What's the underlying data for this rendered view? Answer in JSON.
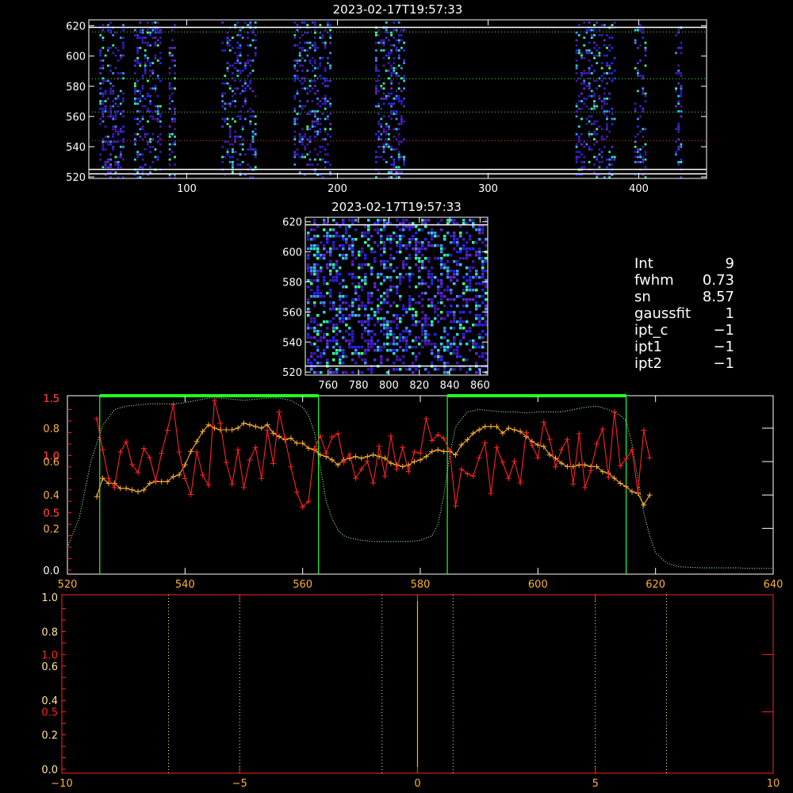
{
  "colors": {
    "background": "#000000",
    "axes": "#ffffff",
    "red": "#ff2222",
    "orange": "#ffb030",
    "green": "#22ff22",
    "light_green": "#aaffaa",
    "pixel_palette": [
      "#3a1aa8",
      "#5a2ad0",
      "#2222ff",
      "#3f8cff",
      "#2ad6d6",
      "#40ff90"
    ]
  },
  "info_panel": [
    {
      "key": "Int",
      "value": "9"
    },
    {
      "key": "fwhm",
      "value": "0.73"
    },
    {
      "key": "sn",
      "value": "8.57"
    },
    {
      "key": "gaussfit",
      "value": "1"
    },
    {
      "key": "ipt_c",
      "value": "−1"
    },
    {
      "key": "ipt1",
      "value": "−1"
    },
    {
      "key": "ipt2",
      "value": "−1"
    }
  ],
  "chart_data": [
    {
      "id": "top-image",
      "type": "heatmap",
      "title": "2023-02-17T19:57:33",
      "xlim": [
        35,
        445
      ],
      "ylim": [
        519,
        624
      ],
      "xticks": [
        100,
        200,
        300,
        400
      ],
      "yticks": [
        520,
        540,
        560,
        580,
        600,
        620
      ],
      "bands_x": [
        [
          42,
          58
        ],
        [
          65,
          82
        ],
        [
          88,
          92
        ],
        [
          123,
          146
        ],
        [
          171,
          196
        ],
        [
          225,
          244
        ],
        [
          358,
          384
        ],
        [
          397,
          404
        ],
        [
          424,
          428
        ]
      ],
      "h_lines_white": [
        619,
        525,
        522
      ],
      "h_lines_green_dotted": [
        616,
        585,
        563
      ],
      "h_lines_red_dotted": [
        544
      ]
    },
    {
      "id": "middle-image",
      "type": "heatmap",
      "title": "2023-02-17T19:57:33",
      "xlim": [
        745,
        865
      ],
      "ylim": [
        518,
        623
      ],
      "xticks": [
        760,
        780,
        800,
        820,
        840,
        860
      ],
      "yticks": [
        520,
        540,
        560,
        580,
        600,
        620
      ],
      "h_lines_white": [
        618,
        524
      ]
    },
    {
      "id": "spectrum",
      "type": "line",
      "xlim": [
        520,
        640
      ],
      "xticks": [
        520,
        540,
        560,
        580,
        600,
        620,
        640
      ],
      "left_axis_white": {
        "ylim": [
          0,
          1.5
        ],
        "ticks": [
          "0.0",
          "0.5",
          "1.0",
          "1.5"
        ]
      },
      "left_axis_orange": {
        "ylim": [
          -0.05,
          0.98
        ],
        "ticks": [
          "0.2",
          "0.4",
          "0.6",
          "0.8"
        ]
      },
      "left_axis_red": {
        "ylim": [
          0,
          1.5
        ],
        "ticks": [
          "0.5",
          "1.0",
          "1.5"
        ]
      },
      "green_windows": [
        [
          525.5,
          562.7
        ],
        [
          584.6,
          615
        ]
      ],
      "series": [
        {
          "color_key": "light_green",
          "style": "dotted",
          "axis": "white",
          "x": [
            520,
            522,
            524,
            526,
            528,
            530,
            532,
            534,
            536,
            538,
            540,
            542,
            544,
            546,
            548,
            550,
            552,
            554,
            556,
            558,
            560,
            561,
            562,
            563,
            564,
            565,
            566,
            567,
            568,
            570,
            572,
            574,
            576,
            578,
            580,
            582,
            583,
            584,
            585,
            586,
            588,
            590,
            592,
            594,
            596,
            598,
            600,
            602,
            604,
            606,
            608,
            610,
            612,
            614,
            615,
            616,
            617,
            618,
            619,
            620,
            622,
            624,
            626,
            628,
            630,
            632,
            634,
            636,
            638,
            640
          ],
          "values": [
            0.2,
            0.45,
            0.95,
            1.26,
            1.4,
            1.43,
            1.44,
            1.45,
            1.45,
            1.45,
            1.46,
            1.48,
            1.5,
            1.5,
            1.49,
            1.48,
            1.49,
            1.5,
            1.5,
            1.48,
            1.42,
            1.35,
            1.2,
            0.9,
            0.6,
            0.45,
            0.35,
            0.3,
            0.28,
            0.26,
            0.25,
            0.25,
            0.25,
            0.25,
            0.26,
            0.3,
            0.4,
            0.65,
            1.0,
            1.25,
            1.38,
            1.4,
            1.39,
            1.38,
            1.38,
            1.37,
            1.38,
            1.38,
            1.38,
            1.4,
            1.42,
            1.43,
            1.4,
            1.35,
            1.3,
            1.1,
            0.8,
            0.5,
            0.3,
            0.15,
            0.06,
            0.03,
            0.025,
            0.02,
            0.02,
            0.02,
            0.02,
            0.015,
            0.015,
            0.015
          ]
        },
        {
          "color_key": "orange",
          "style": "plus-line",
          "axis": "orange",
          "x": [
            525,
            526,
            527,
            528,
            529,
            530,
            531,
            532,
            533,
            534,
            535,
            536,
            537,
            538,
            539,
            540,
            541,
            542,
            543,
            544,
            545,
            546,
            547,
            548,
            549,
            550,
            551,
            552,
            553,
            554,
            555,
            556,
            557,
            558,
            559,
            560,
            561,
            562,
            563,
            564,
            565,
            566,
            567,
            568,
            569,
            570,
            571,
            572,
            573,
            574,
            575,
            576,
            577,
            578,
            579,
            580,
            581,
            582,
            583,
            584,
            585,
            586,
            587,
            588,
            589,
            590,
            591,
            592,
            593,
            594,
            595,
            596,
            597,
            598,
            599,
            600,
            601,
            602,
            603,
            604,
            605,
            606,
            607,
            608,
            609,
            610,
            611,
            612,
            613,
            614,
            615,
            616,
            617,
            618,
            619
          ],
          "values": [
            0.39,
            0.5,
            0.47,
            0.47,
            0.44,
            0.44,
            0.43,
            0.42,
            0.43,
            0.47,
            0.48,
            0.48,
            0.48,
            0.51,
            0.52,
            0.58,
            0.66,
            0.72,
            0.78,
            0.82,
            0.8,
            0.79,
            0.79,
            0.79,
            0.8,
            0.83,
            0.82,
            0.81,
            0.8,
            0.82,
            0.77,
            0.75,
            0.73,
            0.74,
            0.71,
            0.71,
            0.68,
            0.67,
            0.64,
            0.63,
            0.61,
            0.58,
            0.61,
            0.62,
            0.63,
            0.62,
            0.63,
            0.64,
            0.63,
            0.62,
            0.59,
            0.58,
            0.57,
            0.58,
            0.6,
            0.61,
            0.63,
            0.66,
            0.67,
            0.66,
            0.66,
            0.64,
            0.7,
            0.73,
            0.77,
            0.79,
            0.81,
            0.81,
            0.81,
            0.77,
            0.8,
            0.79,
            0.78,
            0.75,
            0.72,
            0.7,
            0.69,
            0.64,
            0.62,
            0.59,
            0.57,
            0.57,
            0.58,
            0.58,
            0.57,
            0.57,
            0.54,
            0.53,
            0.5,
            0.47,
            0.45,
            0.42,
            0.41,
            0.34,
            0.4
          ]
        },
        {
          "color_key": "red",
          "style": "plus-line",
          "axis": "red",
          "x": [
            525,
            526,
            527,
            528,
            529,
            530,
            531,
            532,
            533,
            534,
            535,
            536,
            537,
            538,
            539,
            540,
            541,
            542,
            543,
            544,
            545,
            546,
            547,
            548,
            549,
            550,
            551,
            552,
            553,
            554,
            555,
            556,
            557,
            558,
            559,
            560,
            561,
            562,
            563,
            564,
            565,
            566,
            567,
            568,
            569,
            570,
            571,
            572,
            573,
            574,
            575,
            576,
            577,
            578,
            579,
            580,
            581,
            582,
            583,
            584,
            585,
            586,
            587,
            588,
            589,
            590,
            591,
            592,
            593,
            594,
            595,
            596,
            597,
            598,
            599,
            600,
            601,
            602,
            603,
            604,
            605,
            606,
            607,
            608,
            609,
            610,
            611,
            612,
            613,
            614,
            615,
            616,
            617,
            618,
            619
          ],
          "values": [
            1.32,
            1.05,
            0.8,
            0.72,
            1.03,
            1.12,
            0.92,
            0.85,
            1.06,
            0.98,
            0.78,
            1.02,
            1.22,
            1.44,
            1.03,
            0.8,
            0.66,
            1.03,
            0.83,
            0.74,
            1.48,
            1.28,
            0.94,
            0.75,
            1.05,
            0.72,
            0.96,
            1.07,
            0.8,
            1.22,
            0.93,
            1.38,
            1.15,
            0.9,
            0.68,
            0.55,
            0.6,
            1.06,
            1.17,
            1.02,
            1.16,
            1.19,
            0.94,
            1.01,
            0.8,
            0.88,
            0.95,
            0.76,
            1.08,
            0.82,
            1.17,
            0.88,
            1.07,
            0.86,
            1.03,
            1.02,
            1.32,
            1.13,
            1.18,
            1.15,
            1.04,
            0.56,
            0.88,
            0.84,
            0.82,
            0.98,
            1.11,
            0.67,
            1.07,
            0.94,
            0.8,
            0.95,
            0.76,
            1.2,
            1.09,
            0.98,
            1.29,
            1.14,
            0.9,
            1.05,
            1.14,
            0.75,
            1.19,
            0.72,
            0.87,
            1.1,
            1.23,
            0.81,
            1.38,
            0.91,
            0.97,
            1.05,
            0.68,
            1.22,
            0.98
          ]
        }
      ]
    },
    {
      "id": "bottom-panel",
      "type": "line",
      "xlim": [
        -10,
        10
      ],
      "xticks": [
        -10,
        -5,
        0,
        5,
        10
      ],
      "left_axis_white": {
        "ylim": [
          0,
          1
        ],
        "ticks": [
          "0.0",
          "0.2",
          "0.4",
          "0.6",
          "0.8",
          "1.0"
        ]
      },
      "left_axis_red": {
        "ylim": [
          0,
          1.5
        ],
        "ticks": [
          "0.5",
          "1.0"
        ]
      },
      "vlines_dotted_yellow": [
        -7,
        -5,
        5,
        7
      ],
      "vlines_dotted_green": [
        -1,
        1
      ],
      "vline_orange": 0
    }
  ]
}
